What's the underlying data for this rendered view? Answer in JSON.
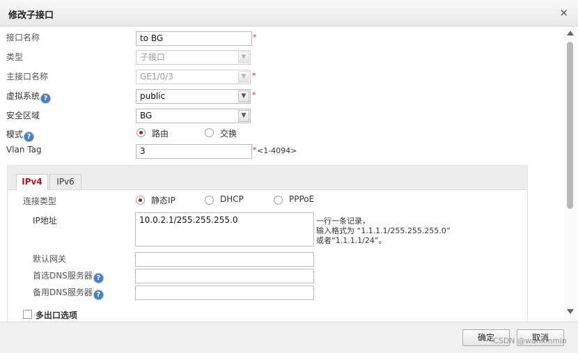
{
  "dialog": {
    "title": "修改子接口",
    "close_glyph": "×"
  },
  "form": {
    "interface_name": {
      "label": "接口名称",
      "value": "to BG",
      "required": "*"
    },
    "type": {
      "label": "类型",
      "value": "子接口"
    },
    "main_interface": {
      "label": "主接口名称",
      "value": "GE1/0/3",
      "required": "*"
    },
    "virtual_system": {
      "label": "虚拟系统",
      "help": "?",
      "value": "public",
      "required": "*"
    },
    "security_zone": {
      "label": "安全区域",
      "value": "BG"
    },
    "mode": {
      "label": "模式",
      "help": "?",
      "options": [
        {
          "label": "路由",
          "selected": true
        },
        {
          "label": "交换",
          "selected": false
        }
      ]
    },
    "vlan_tag": {
      "label": "Vlan Tag",
      "value": "3",
      "required": "*",
      "range_hint": "<1-4094>"
    }
  },
  "tabs": [
    {
      "label": "IPv4",
      "active": true
    },
    {
      "label": "IPv6",
      "active": false
    }
  ],
  "ipv4": {
    "connection_type": {
      "label": "连接类型",
      "options": [
        {
          "label": "静态IP",
          "selected": true
        },
        {
          "label": "DHCP",
          "selected": false
        },
        {
          "label": "PPPoE",
          "selected": false
        }
      ]
    },
    "ip_address": {
      "label": "IP地址",
      "value": "10.0.2.1/255.255.255.0",
      "hint_line1": "一行一条记录，",
      "hint_line2": "输入格式为 “1.1.1.1/255.255.255.0”",
      "hint_line3": "或者“1.1.1.1/24”。"
    },
    "default_gateway": {
      "label": "默认网关",
      "value": ""
    },
    "primary_dns": {
      "label": "首选DNS服务器",
      "help": "?",
      "value": ""
    },
    "secondary_dns": {
      "label": "备用DNS服务器",
      "help": "?",
      "value": ""
    },
    "multi_egress": {
      "label": "多出口选项",
      "checked": false
    }
  },
  "footer": {
    "ok_label": "确定",
    "cancel_label": "取消",
    "watermark": "CSDN @wanxinmin"
  },
  "icons": {
    "select_arrow": "chevron-down-icon",
    "help": "help-icon",
    "close": "close-icon"
  },
  "colors": {
    "accent": "#b4121b",
    "required": "#e0242c",
    "help_badge": "#4a7fc3"
  }
}
